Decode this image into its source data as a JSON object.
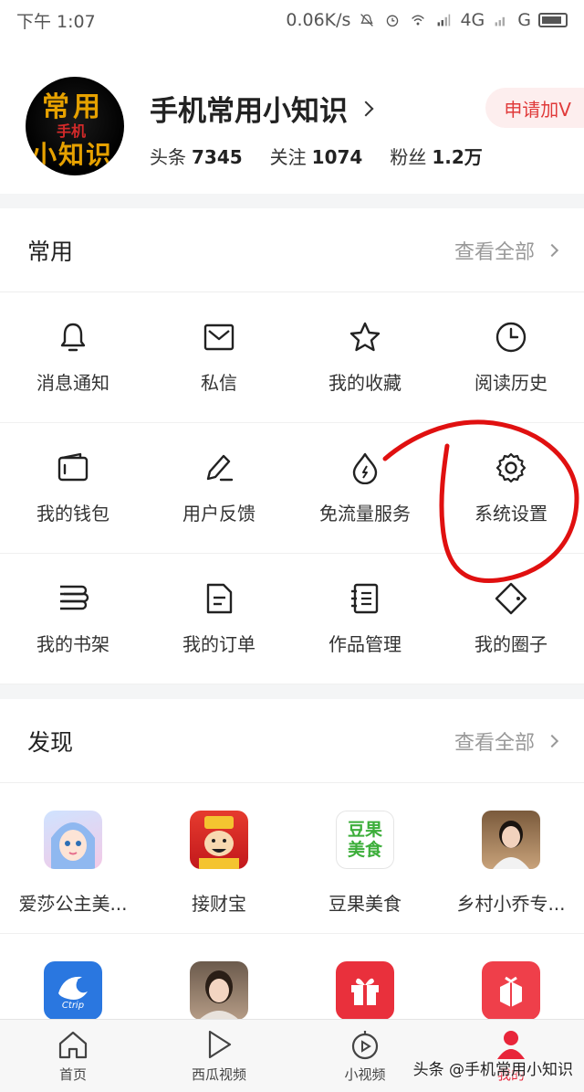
{
  "status_bar": {
    "time": "下午 1:07",
    "network_speed": "0.06K/s",
    "network_type": "4G",
    "sim2": "G"
  },
  "profile": {
    "name": "手机常用小知识",
    "avatar_text_top": "常用",
    "avatar_text_mid": "手机",
    "avatar_text_bottom": "小知识",
    "stats": [
      {
        "label": "头条",
        "value": "7345"
      },
      {
        "label": "关注",
        "value": "1074"
      },
      {
        "label": "粉丝",
        "value": "1.2万"
      }
    ],
    "apply_v_label": "申请加V"
  },
  "common": {
    "title": "常用",
    "more_label": "查看全部",
    "items": [
      {
        "label": "消息通知",
        "icon": "bell-icon"
      },
      {
        "label": "私信",
        "icon": "mail-icon"
      },
      {
        "label": "我的收藏",
        "icon": "star-icon"
      },
      {
        "label": "阅读历史",
        "icon": "clock-icon"
      },
      {
        "label": "我的钱包",
        "icon": "wallet-icon"
      },
      {
        "label": "用户反馈",
        "icon": "pen-icon"
      },
      {
        "label": "免流量服务",
        "icon": "drop-icon"
      },
      {
        "label": "系统设置",
        "icon": "gear-icon"
      },
      {
        "label": "我的书架",
        "icon": "bookshelf-icon"
      },
      {
        "label": "我的订单",
        "icon": "document-icon"
      },
      {
        "label": "作品管理",
        "icon": "notebook-icon"
      },
      {
        "label": "我的圈子",
        "icon": "circle-tag-icon"
      }
    ]
  },
  "discover": {
    "title": "发现",
    "more_label": "查看全部",
    "apps": [
      {
        "label": "爱莎公主美...",
        "icon": "princess-app-icon"
      },
      {
        "label": "接财宝",
        "icon": "fortune-app-icon"
      },
      {
        "label": "豆果美食",
        "icon": "douguo-app-icon",
        "icon_text": "豆果美食"
      },
      {
        "label": "乡村小乔专...",
        "icon": "portrait-app-icon"
      },
      {
        "label": "",
        "icon": "ctrip-app-icon",
        "icon_text": "Ctrip"
      },
      {
        "label": "",
        "icon": "portrait2-app-icon"
      },
      {
        "label": "",
        "icon": "gift-app-icon"
      },
      {
        "label": "",
        "icon": "box-app-icon"
      }
    ]
  },
  "bottom_nav": {
    "items": [
      {
        "label": "首页",
        "icon": "home-icon"
      },
      {
        "label": "西瓜视频",
        "icon": "play-icon"
      },
      {
        "label": "小视频",
        "icon": "short-video-icon"
      },
      {
        "label": "我的",
        "icon": "user-icon"
      }
    ]
  },
  "watermark": "头条 @手机常用小知识",
  "colors": {
    "accent_red": "#e8253a",
    "annotation_red": "#e01010",
    "muted": "#999999"
  }
}
